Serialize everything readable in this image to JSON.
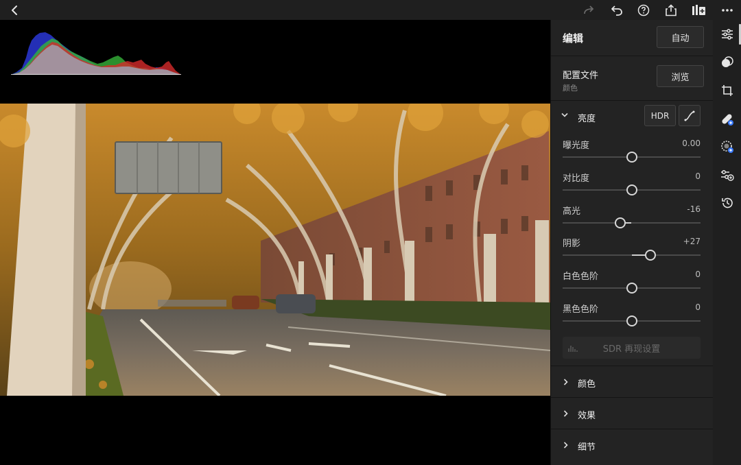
{
  "topbar": {
    "icons": [
      "back-icon",
      "redo-icon",
      "undo-icon",
      "help-icon",
      "share-icon",
      "add-copy-icon",
      "more-icon"
    ]
  },
  "panel": {
    "edit_title": "编辑",
    "auto_label": "自动",
    "profile_label": "配置文件",
    "profile_value": "颜色",
    "browse_label": "浏览",
    "light": {
      "title": "亮度",
      "hdr_label": "HDR",
      "sliders": [
        {
          "label": "曝光度",
          "value": "0.00",
          "position": 0.5
        },
        {
          "label": "对比度",
          "value": "0",
          "position": 0.5
        },
        {
          "label": "高光",
          "value": "-16",
          "position": 0.42
        },
        {
          "label": "阴影",
          "value": "+27",
          "position": 0.635
        },
        {
          "label": "白色色阶",
          "value": "0",
          "position": 0.5
        },
        {
          "label": "黑色色阶",
          "value": "0",
          "position": 0.5
        }
      ],
      "sdr_button": "SDR 再现设置"
    },
    "collapsed_sections": [
      {
        "label": "颜色"
      },
      {
        "label": "效果"
      },
      {
        "label": "细节"
      }
    ]
  },
  "toolstrip": {
    "icons": [
      "edit-sliders-icon",
      "masking-icon",
      "crop-icon",
      "healing-icon",
      "effects-icon",
      "presets-icon",
      "history-icon"
    ]
  },
  "colors": {
    "panel_bg": "#232323",
    "topbar_bg": "#1f1f1f",
    "canvas_bg": "#000000"
  }
}
